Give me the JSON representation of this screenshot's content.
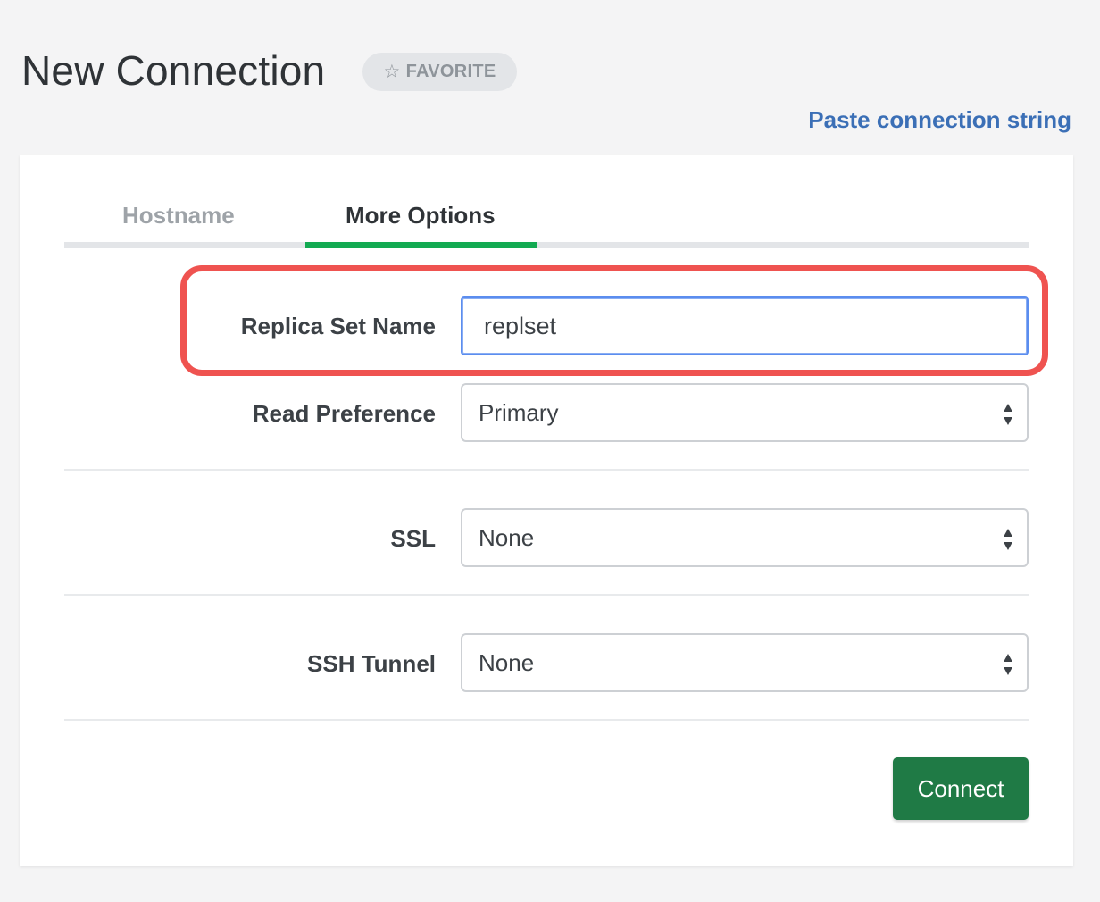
{
  "header": {
    "title": "New Connection",
    "favorite_label": "FAVORITE",
    "paste_link": "Paste connection string"
  },
  "tabs": [
    {
      "label": "Hostname",
      "active": false
    },
    {
      "label": "More Options",
      "active": true
    }
  ],
  "form": {
    "replica_set": {
      "label": "Replica Set Name",
      "value": "replset"
    },
    "read_preference": {
      "label": "Read Preference",
      "value": "Primary"
    },
    "ssl": {
      "label": "SSL",
      "value": "None"
    },
    "ssh_tunnel": {
      "label": "SSH Tunnel",
      "value": "None"
    }
  },
  "actions": {
    "connect_label": "Connect"
  },
  "colors": {
    "accent_green": "#13aa52",
    "connect_button": "#1f7a45",
    "link_blue": "#3b6fb6",
    "highlight_red": "#ef5350"
  },
  "icons": {
    "favorite": "star-outline-icon",
    "select": "sort-arrows-icon"
  }
}
